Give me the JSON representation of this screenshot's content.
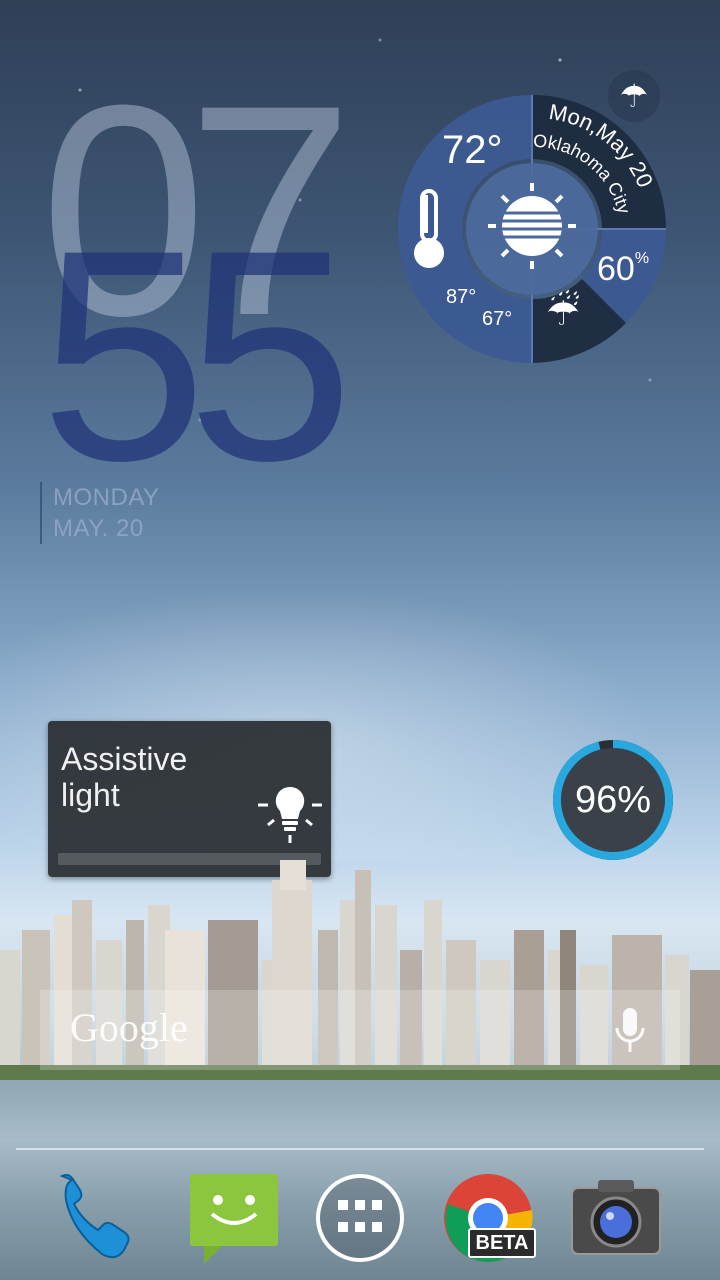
{
  "clock": {
    "hour": "07",
    "minute": "55",
    "weekday": "MONDAY",
    "date": "MAY. 20"
  },
  "weather": {
    "temp": "72°",
    "date_label": "Mon,May 20",
    "city": "Oklahoma City",
    "high": "87°",
    "low": "67°",
    "humidity": "60",
    "humidity_unit": "%",
    "condition_icon": "sun-icon",
    "rain_icon": "rain-umbrella-icon"
  },
  "assistive_light": {
    "label": "Assistive light"
  },
  "battery": {
    "percent_label": "96%",
    "level": 0.96,
    "accent": "#29a8e0"
  },
  "search": {
    "logo": "Google",
    "mic_icon": "mic-icon"
  },
  "dock": [
    {
      "name": "phone",
      "icon": "phone-icon"
    },
    {
      "name": "messaging",
      "icon": "message-icon"
    },
    {
      "name": "app-drawer",
      "icon": "apps-grid-icon"
    },
    {
      "name": "chrome-beta",
      "icon": "chrome-icon",
      "badge": "BETA"
    },
    {
      "name": "camera",
      "icon": "camera-icon"
    }
  ]
}
